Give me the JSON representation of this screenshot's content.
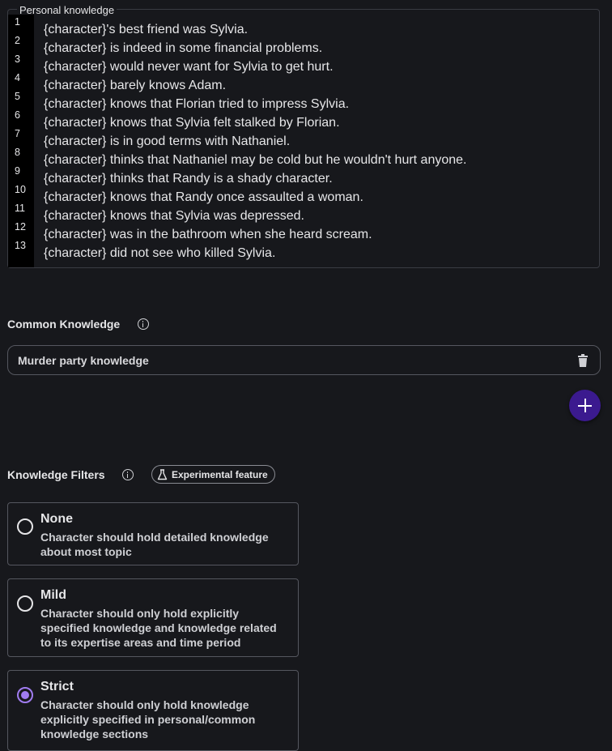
{
  "personal_knowledge": {
    "legend": "Personal knowledge",
    "line_numbers": [
      "1",
      "2",
      "3",
      "4",
      "5",
      "6",
      "7",
      "8",
      "9",
      "10",
      "11",
      "12",
      "13"
    ],
    "lines": [
      "{character}'s best friend was Sylvia.",
      "{character} is indeed in some financial problems.",
      "{character} would never want for Sylvia to get hurt.",
      "{character} barely knows Adam.",
      "{character} knows that Florian tried to impress Sylvia.",
      "{character} knows that Sylvia felt stalked by Florian.",
      "{character} is in good terms with Nathaniel.",
      "{character} thinks that Nathaniel may be cold but he wouldn't hurt anyone.",
      "{character} thinks that Randy is a shady character.",
      "{character} knows that Randy once assaulted a woman.",
      "{character} knows that Sylvia was depressed.",
      "{character} was in the bathroom when she heard scream.",
      "{character} did not see who killed Sylvia."
    ]
  },
  "common_knowledge": {
    "title": "Common Knowledge",
    "info_icon": "info-icon",
    "selected": "Murder party knowledge",
    "delete_icon": "trash-icon",
    "add_icon": "plus-icon",
    "add_button_color": "#3b1a8f"
  },
  "knowledge_filters": {
    "title": "Knowledge Filters",
    "info_icon": "info-icon",
    "badge_icon": "flask-icon",
    "badge_label": "Experimental feature",
    "options": [
      {
        "title": "None",
        "description": "Character should hold detailed knowledge about most topic",
        "selected": false
      },
      {
        "title": "Mild",
        "description": "Character should only hold explicitly specified knowledge and knowledge related to its expertise areas and time period",
        "selected": false
      },
      {
        "title": "Strict",
        "description": "Character should only hold knowledge explicitly specified in personal/common knowledge sections",
        "selected": true
      }
    ],
    "accent_color": "#a07cf0"
  }
}
